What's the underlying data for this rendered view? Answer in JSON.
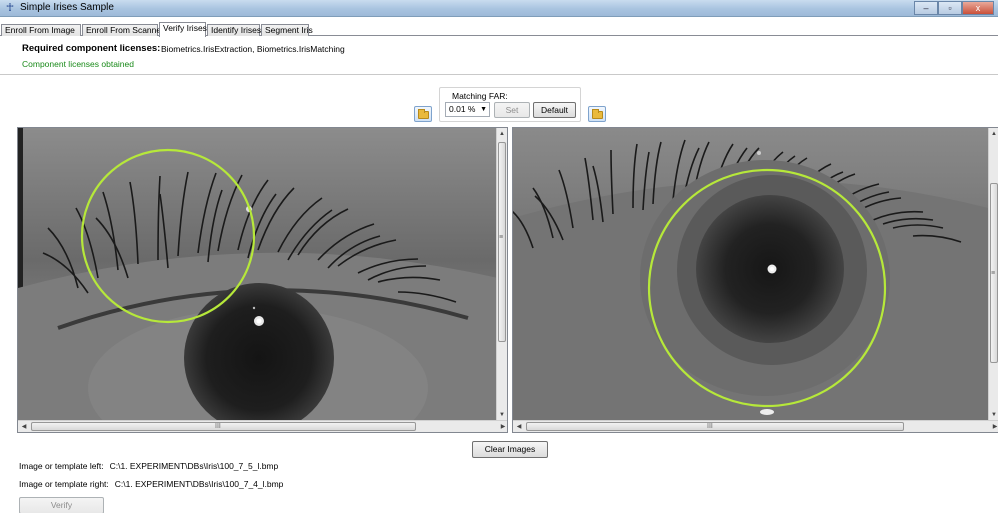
{
  "window": {
    "title": "Simple Irises Sample",
    "controls": [
      "–",
      "▫",
      "x"
    ]
  },
  "tabs": [
    {
      "label": "Enroll From Image"
    },
    {
      "label": "Enroll From Scanner"
    },
    {
      "label": "Verify Irises",
      "active": true
    },
    {
      "label": "Identify Irises"
    },
    {
      "label": "Segment Iris"
    }
  ],
  "licenses": {
    "label": "Required component licenses:",
    "value": "Biometrics.IrisExtraction, Biometrics.IrisMatching",
    "status": "Component licenses obtained",
    "status_color": "#1a8a1a"
  },
  "matching": {
    "label": "Matching FAR:",
    "far_value": "0.01 %",
    "set_label": "Set",
    "default_label": "Default"
  },
  "viewers": {
    "left": {
      "overlay_color": "#b6e83a",
      "hscroll_grip": "III"
    },
    "right": {
      "overlay_color": "#b6e83a",
      "hscroll_grip": "III"
    }
  },
  "clear_images_label": "Clear Images",
  "image_left": {
    "label": "Image or template left:",
    "path": "C:\\1. EXPERIMENT\\DBs\\Iris\\100_7_5_l.bmp"
  },
  "image_right": {
    "label": "Image or template right:",
    "path": "C:\\1. EXPERIMENT\\DBs\\Iris\\100_7_4_l.bmp"
  },
  "verify_label": "Verify"
}
